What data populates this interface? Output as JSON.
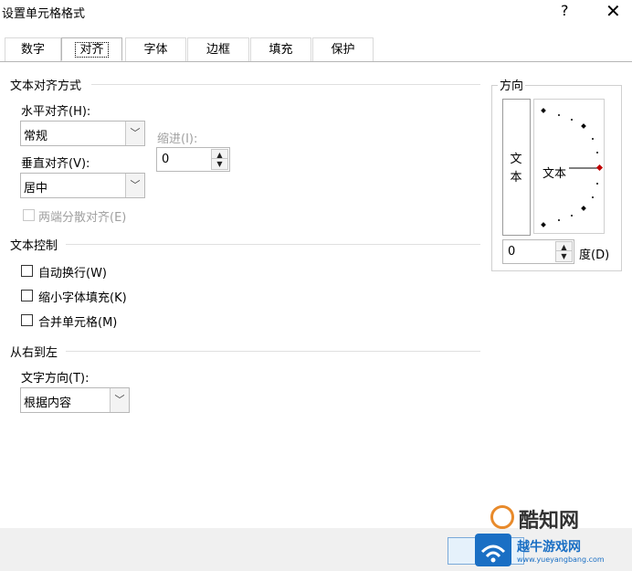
{
  "window": {
    "title": "设置单元格格式",
    "help_label": "?",
    "close_label": "✕"
  },
  "tabs": [
    {
      "label": "数字"
    },
    {
      "label": "对齐"
    },
    {
      "label": "字体"
    },
    {
      "label": "边框"
    },
    {
      "label": "填充"
    },
    {
      "label": "保护"
    }
  ],
  "text_alignment": {
    "group_title": "文本对齐方式",
    "horizontal_label": "水平对齐(H):",
    "horizontal_value": "常规",
    "indent_label": "缩进(I):",
    "indent_value": "0",
    "vertical_label": "垂直对齐(V):",
    "vertical_value": "居中",
    "justify_distributed_label": "两端分散对齐(E)"
  },
  "text_control": {
    "group_title": "文本控制",
    "wrap_text_label": "自动换行(W)",
    "shrink_to_fit_label": "缩小字体填充(K)",
    "merge_cells_label": "合并单元格(M)"
  },
  "rtl": {
    "group_title": "从右到左",
    "direction_label": "文字方向(T):",
    "direction_value": "根据内容"
  },
  "orientation": {
    "group_title": "方向",
    "vertical_text": "文本",
    "horizontal_text": "文本",
    "degree_value": "0",
    "degree_label": "度(D)"
  },
  "watermark": {
    "site_name": "酷知网",
    "site_name2": "越牛游戏网",
    "site_url": "www.yueyangbang.com"
  }
}
